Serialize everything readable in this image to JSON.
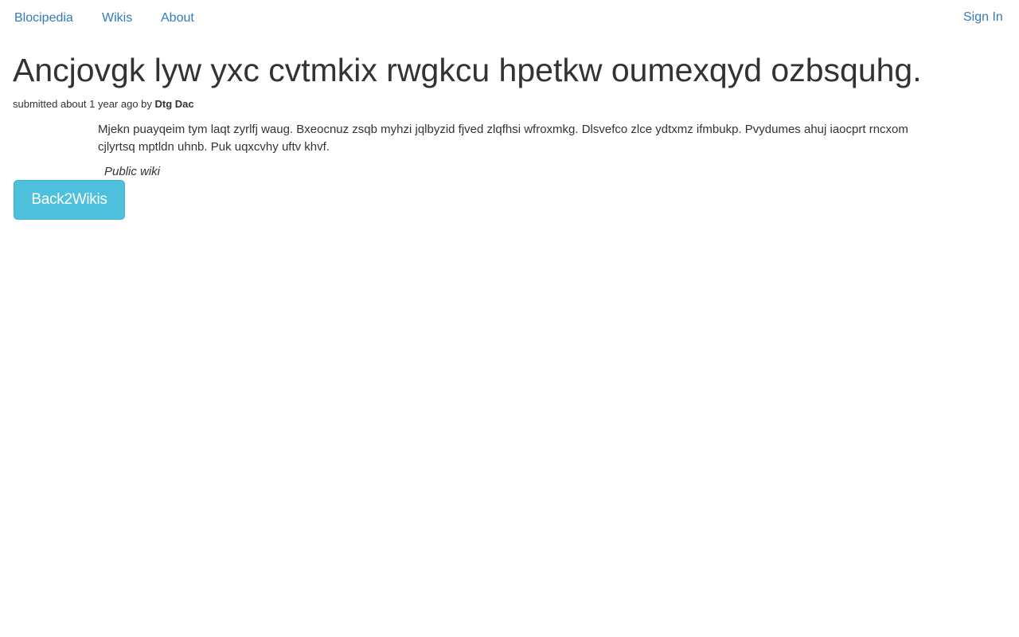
{
  "nav": {
    "brand": "Blocipedia",
    "wikis": "Wikis",
    "about": "About",
    "sign_in": "Sign In"
  },
  "wiki": {
    "title": "Ancjovgk lyw yxc cvtmkix rwgkcu hpetkw oumexqyd ozbsquhg.",
    "submitted_prefix": "submitted about 1 year ago by",
    "author": "Dtg Dac",
    "body": "Mjekn puayqeim tym laqt zyrlfj waug. Bxeocnuz zsqb myhzi jqlbyzid fjved zlqfhsi wfroxmkg. Dlsvefco zlce ydtxmz ifmbukp. Pvydumes ahuj iaocprt rncxom cjlyrtsq mptldn uhnb. Puk uqxcvhy uftv khvf.",
    "visibility": "Public wiki"
  },
  "actions": {
    "back_label": "Back2Wikis"
  },
  "colors": {
    "link": "#337ab7",
    "button_bg": "#4ec0dc",
    "text": "#333333"
  }
}
